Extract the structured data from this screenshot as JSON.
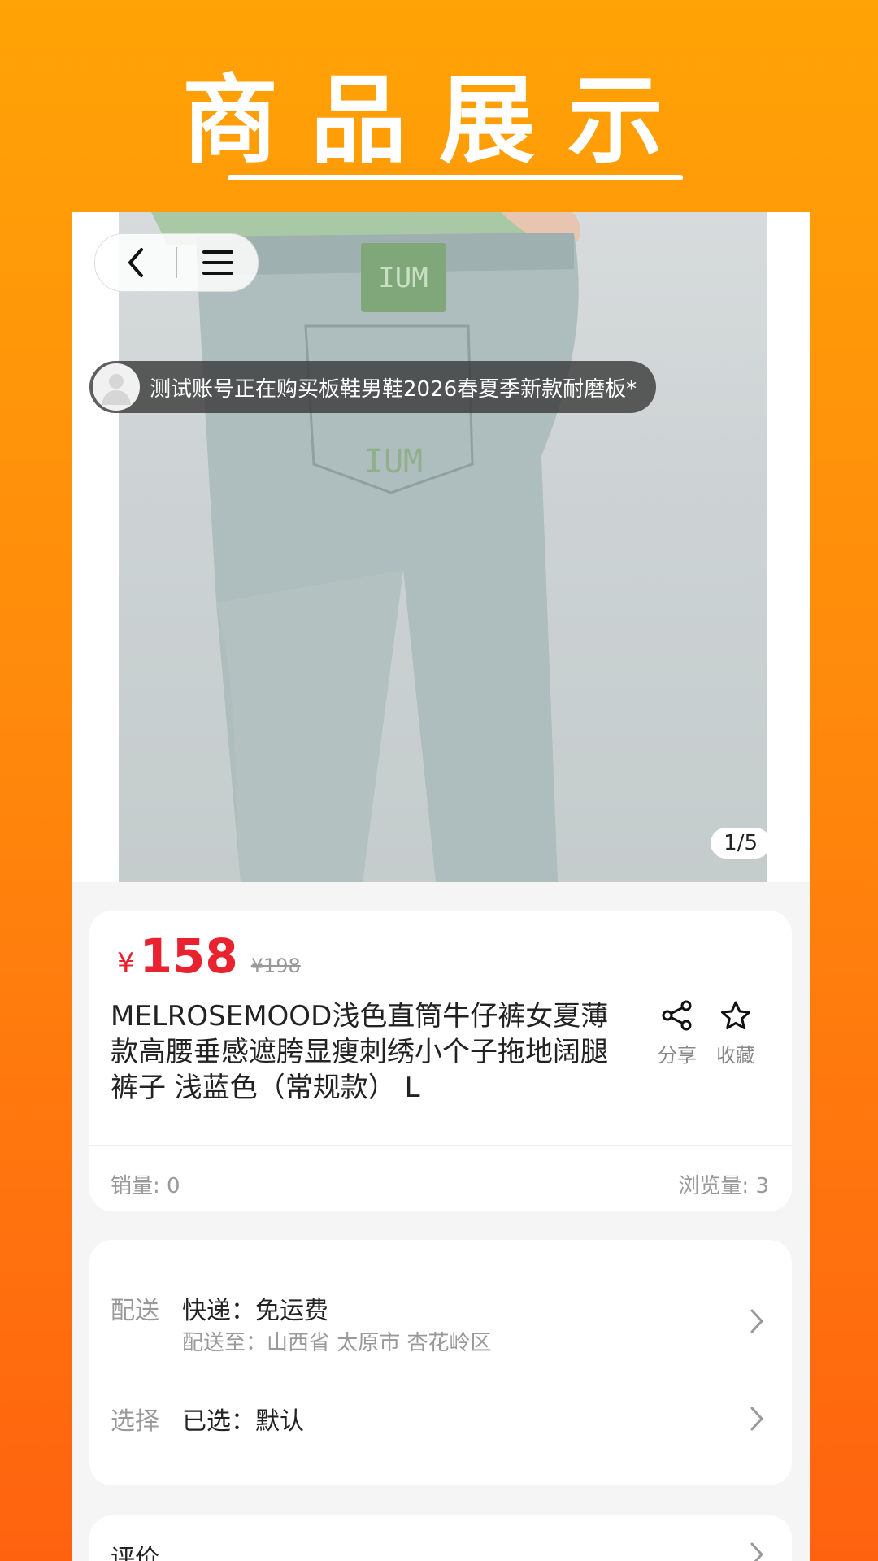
{
  "banner": {
    "title": "商品展示"
  },
  "gallery": {
    "ticker_text": "测试账号正在购买板鞋男鞋2026春夏季新款耐磨板*",
    "page_indicator": "1/5",
    "patch_text": "IUM"
  },
  "product": {
    "currency": "¥",
    "price": "158",
    "original_price": "¥198",
    "title": "MELROSEMOOD浅色直筒牛仔裤女夏薄款高腰垂感遮胯显瘦刺绣小个子拖地阔腿裤子 浅蓝色（常规款） L",
    "share_label": "分享",
    "favorite_label": "收藏",
    "sales": "销量: 0",
    "views": "浏览量: 3"
  },
  "delivery": {
    "label": "配送",
    "value": "快递：免运费",
    "sub": "配送至：山西省 太原市 杏花岭区"
  },
  "selection": {
    "label": "选择",
    "value": "已选：默认"
  },
  "reviews": {
    "label": "评价"
  },
  "colors": {
    "accent": "#e8222e",
    "banner_top": "#ffa306",
    "banner_bottom": "#ff620f"
  },
  "icons": [
    "back-icon",
    "menu-icon",
    "avatar-icon",
    "share-icon",
    "star-icon",
    "chevron-right-icon"
  ]
}
